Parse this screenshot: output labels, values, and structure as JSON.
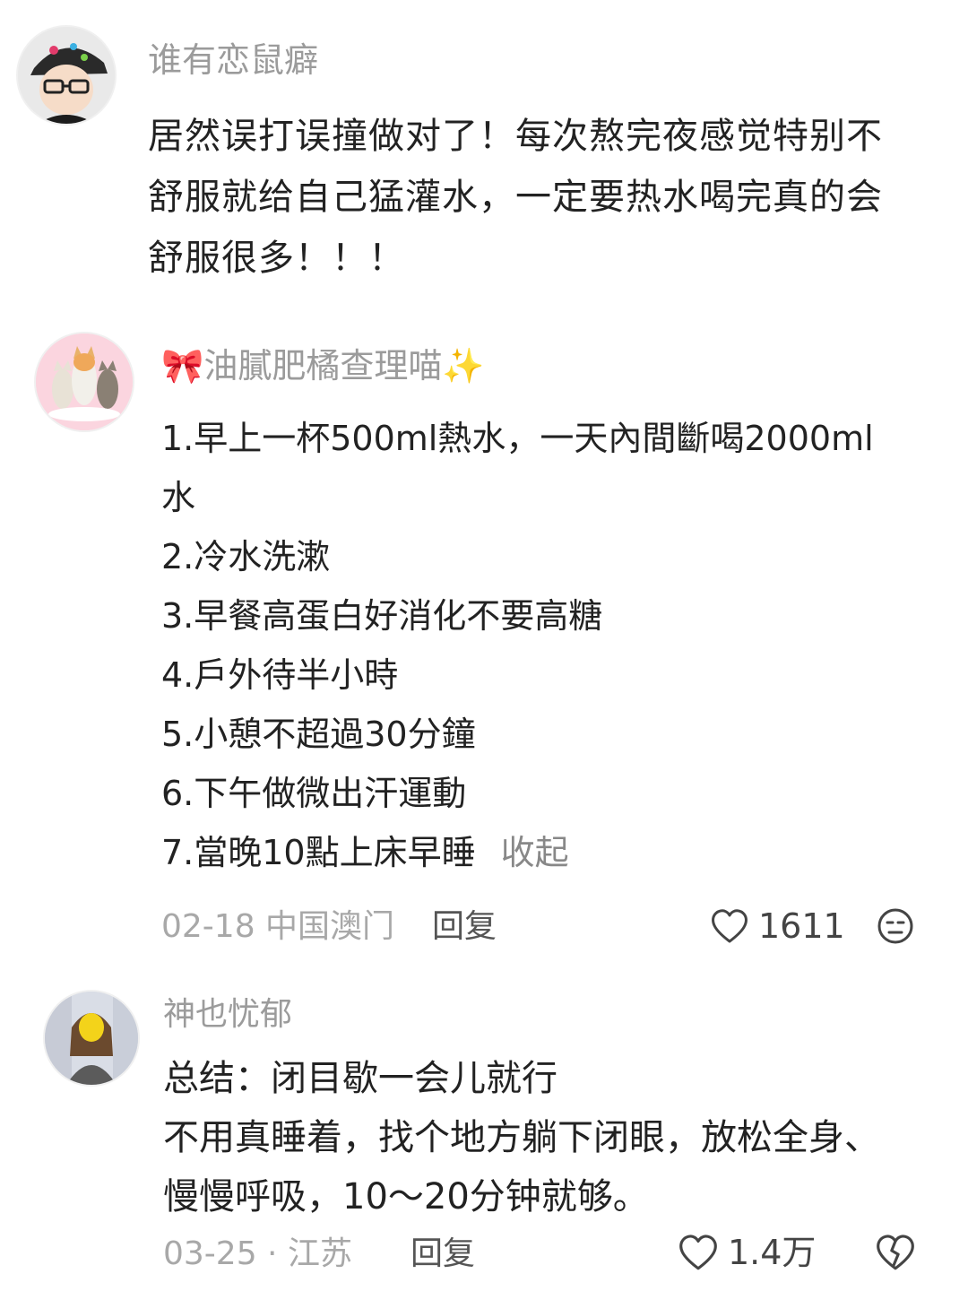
{
  "comments": [
    {
      "username": "谁有恋鼠癖",
      "text_lines": [
        "居然误打误撞做对了！每次熬完夜感觉特别不",
        "舒服就给自己猛灌水，一定要热水喝完真的会",
        "舒服很多！！！"
      ],
      "avatar_icon": "cartoon-boy-cap-avatar"
    },
    {
      "username": "🎀油膩肥橘查理喵✨",
      "text_lines": [
        "1.早上一杯500ml熱水，一天內間斷喝2000ml",
        "水",
        "2.冷水洗漱",
        "3.早餐高蛋白好消化不要高糖",
        "4.戶外待半小時",
        "5.小憩不超過30分鐘",
        "6.下午做微出汗運動",
        "7.當晚10點上床早睡"
      ],
      "collapse_label": "收起",
      "meta": "02-18 中国澳门",
      "reply_label": "回复",
      "like_count": "1611",
      "avatar_icon": "cats-avatar"
    },
    {
      "username": "神也忧郁",
      "text_lines": [
        "总结：闭目歇一会儿就行",
        "不用真睡着，找个地方躺下闭眼，放松全身、",
        "慢慢呼吸，10～20分钟就够。"
      ],
      "meta": "03-25 · 江苏",
      "reply_label": "回复",
      "like_count": "1.4万",
      "avatar_icon": "girl-photo-avatar"
    }
  ],
  "colors": {
    "username": "#9b9b9b",
    "body_text": "#222222",
    "meta": "#a8a8a8",
    "icon_stroke": "#444444"
  }
}
